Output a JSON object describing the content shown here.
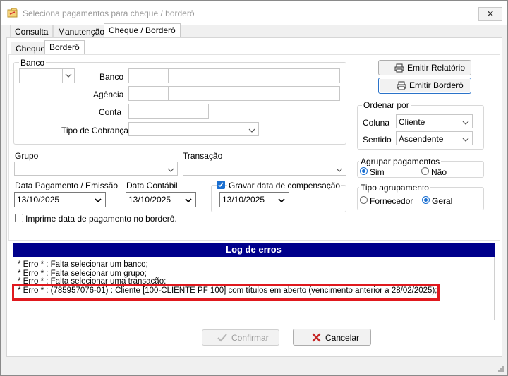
{
  "window": {
    "title": "Seleciona pagamentos para cheque / borderô",
    "close_symbol": "✕"
  },
  "main_tabs": [
    {
      "label": "Consulta"
    },
    {
      "label": "Manutenção"
    },
    {
      "label": "Cheque / Borderô"
    }
  ],
  "sub_tabs": [
    {
      "label": "Cheque"
    },
    {
      "label": "Borderô"
    }
  ],
  "bank_group": {
    "legend": "Banco",
    "banco_label": "Banco",
    "agencia_label": "Agência",
    "conta_label": "Conta",
    "tipo_cobranca_label": "Tipo de Cobrança"
  },
  "grupo_label": "Grupo",
  "transacao_label": "Transação",
  "data_pagamento": {
    "label": "Data Pagamento / Emissão",
    "value": "13/10/2025"
  },
  "data_contabil": {
    "label": "Data Contábil",
    "value": "13/10/2025"
  },
  "gravar_data": {
    "label": "Gravar data de compensação",
    "checked": true,
    "value": "13/10/2025"
  },
  "imprime_data": {
    "label": "Imprime data de pagamento no borderô.",
    "checked": false
  },
  "buttons": {
    "emitir_relatorio": "Emitir Relatório",
    "emitir_bordero": "Emitir Borderô",
    "confirmar": "Confirmar",
    "cancelar": "Cancelar"
  },
  "ordenar": {
    "legend": "Ordenar por",
    "coluna_label": "Coluna",
    "coluna_value": "Cliente",
    "sentido_label": "Sentido",
    "sentido_value": "Ascendente"
  },
  "agrupar": {
    "legend": "Agrupar pagamentos",
    "sim": "Sim",
    "nao": "Não",
    "selected": "Sim"
  },
  "tipo_agrupamento": {
    "legend": "Tipo agrupamento",
    "fornecedor": "Fornecedor",
    "geral": "Geral",
    "selected": "Geral"
  },
  "log": {
    "title": "Log de erros",
    "lines": [
      "* Erro * : Falta selecionar um banco;",
      "* Erro * : Falta selecionar um grupo;",
      "* Erro * : Falta selecionar uma transação;",
      "* Erro * : (785957076-01) : Cliente [100-CLIENTE PF 100] com títulos em aberto (vencimento anterior a 28/02/2025);"
    ]
  },
  "colors": {
    "log_header_bg": "#00008b",
    "highlight": "#e0191e",
    "accent": "#1a6fd1"
  }
}
